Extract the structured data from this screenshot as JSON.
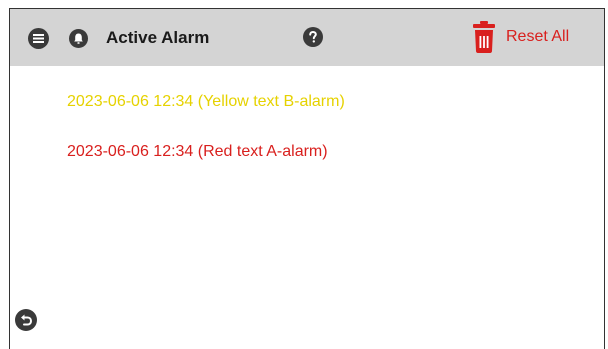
{
  "header": {
    "title": "Active Alarm",
    "reset_label": "Reset All",
    "icons": {
      "menu": "menu-icon",
      "bell": "bell-icon",
      "help": "help-icon",
      "trash": "trash-icon"
    }
  },
  "alarms": [
    {
      "text": "2023-06-06 12:34 (Yellow text B-alarm)",
      "color": "#e6d200",
      "class": "B"
    },
    {
      "text": "2023-06-06 12:34 (Red text A-alarm)",
      "color": "#d9201e",
      "class": "A"
    }
  ],
  "footer": {
    "back_icon": "back-icon"
  },
  "colors": {
    "header_bg": "#d4d4d4",
    "accent_red": "#d9201e",
    "alarm_yellow": "#e6d200",
    "icon_dark": "#3a3a3a"
  }
}
